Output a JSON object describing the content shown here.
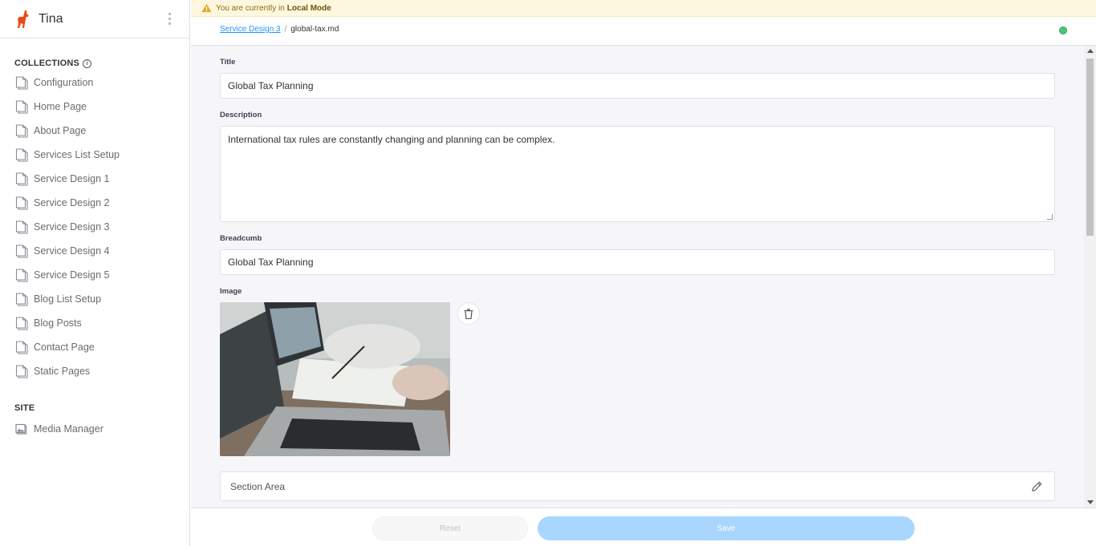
{
  "app": {
    "title": "Tina"
  },
  "sidebar": {
    "collections_title": "COLLECTIONS",
    "collections": [
      {
        "label": "Configuration"
      },
      {
        "label": "Home Page"
      },
      {
        "label": "About Page"
      },
      {
        "label": "Services List Setup"
      },
      {
        "label": "Service Design 1"
      },
      {
        "label": "Service Design 2"
      },
      {
        "label": "Service Design 3"
      },
      {
        "label": "Service Design 4"
      },
      {
        "label": "Service Design 5"
      },
      {
        "label": "Blog List Setup"
      },
      {
        "label": "Blog Posts"
      },
      {
        "label": "Contact Page"
      },
      {
        "label": "Static Pages"
      }
    ],
    "site_title": "SITE",
    "site_items": [
      {
        "label": "Media Manager"
      }
    ]
  },
  "banner": {
    "text": "You are currently in",
    "mode": "Local Mode"
  },
  "breadcrumb": {
    "parent": "Service Design 3",
    "separator": "/",
    "file": "global-tax.md"
  },
  "form": {
    "title_label": "Title",
    "title_value": "Global Tax Planning",
    "description_label": "Description",
    "description_value": "International tax rules are constantly changing and planning can be complex.",
    "breadcrumb_label": "Breadcumb",
    "breadcrumb_value": "Global Tax Planning",
    "image_label": "Image",
    "section_area_label": "Section Area"
  },
  "footer": {
    "reset_label": "Reset",
    "save_label": "Save"
  },
  "colors": {
    "accent": "#2296fe",
    "brand_orange": "#ec4815",
    "status_green": "#48c774",
    "banner_bg": "#fdf7dd"
  }
}
